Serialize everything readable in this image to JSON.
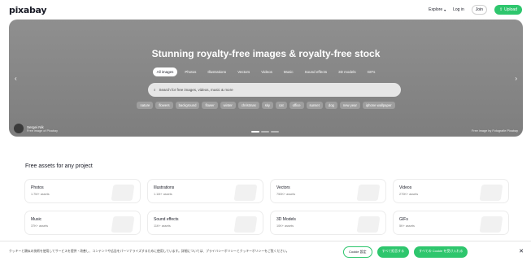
{
  "header": {
    "logo": "pixabay",
    "explore_label": "Explore",
    "login_label": "Log in",
    "join_label": "Join",
    "upload_label": "Upload"
  },
  "hero": {
    "title": "Stunning royalty-free images & royalty-free stock",
    "tabs": [
      "All images",
      "Photos",
      "Illustrations",
      "Vectors",
      "Videos",
      "Music",
      "Sound effects",
      "3D models",
      "GIFs"
    ],
    "active_tab": 0,
    "search_placeholder": "Search for free images, videos, music & more",
    "chips": [
      "nature",
      "flowers",
      "background",
      "flower",
      "winter",
      "christmas",
      "sky",
      "cat",
      "office",
      "sunset",
      "dog",
      "new year",
      "iphone wallpaper"
    ],
    "photographer_name": "Sergei Nik",
    "photographer_sub": "Free image of Pixabay",
    "background_credit": "Free image by Fotografie Pixabay"
  },
  "assets": {
    "title": "Free assets for any project",
    "cards": [
      {
        "label": "Photos",
        "count": "1.7M+ assets"
      },
      {
        "label": "Illustrations",
        "count": "1.1M+ assets"
      },
      {
        "label": "Vectors",
        "count": "750K+ assets"
      },
      {
        "label": "Videos",
        "count": "270K+ assets"
      },
      {
        "label": "Music",
        "count": "37K+ assets"
      },
      {
        "label": "Sound effects",
        "count": "11K+ assets"
      },
      {
        "label": "3D Models",
        "count": "10K+ assets"
      },
      {
        "label": "GIFs",
        "count": "5K+ assets"
      }
    ]
  },
  "cookie": {
    "text": "クッキーと類似の技術を使用してサービスを提供・改善し、コンテンツや広告をパーソナライズするために使用しています。詳細については、プライバシーポリシーとクッキーポリシーをご覧ください。",
    "settings_label": "Cookie 設定",
    "reject_label": "すべて拒否する",
    "accept_label": "すべての Cookie を受け入れる"
  },
  "colors": {
    "accent": "#2ec66d",
    "hero_bg": "#858585"
  }
}
